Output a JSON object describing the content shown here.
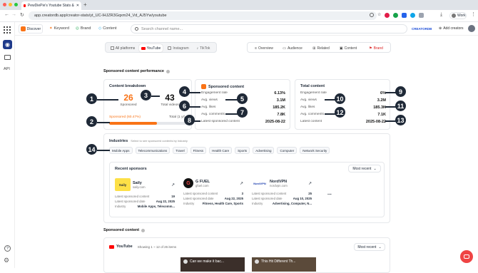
{
  "browser": {
    "tab_title": "PewDiePie's Youtube Stats &",
    "url": "app.creatordb.app/creator-stats/yt_UC-lHJZR3Gqxm24_Vd_AJ5Yw/youtube",
    "profile_label": "Work"
  },
  "topnav": {
    "discover": "Discover",
    "keyword": "Keyword",
    "brand": "Brand",
    "content": "Content",
    "search_placeholder": "Search channel name...",
    "plan_badge": "CREATORDB",
    "add_creators": "Add creators"
  },
  "sidebar": {
    "api_label": "API"
  },
  "platform_tabs": [
    "All platforms",
    "YouTube",
    "Instagram",
    "TikTok"
  ],
  "view_tabs": [
    "Overview",
    "Audience",
    "Related",
    "Content",
    "Brand"
  ],
  "section_title": "Sponsored content performance",
  "breakdown": {
    "title": "Content breakdown",
    "sponsored_value": "26",
    "sponsored_label": "Sponsored",
    "total_value": "43",
    "total_label": "Total videos",
    "bar_sponsored_label": "Sponsored (60.47%)",
    "bar_total_label": "Total (1 yr)",
    "sponsored_fraction": 0.6047
  },
  "sponsored_content": {
    "title": "Sponsored content",
    "rows": [
      {
        "label": "Engagement rate",
        "value": "6.13%"
      },
      {
        "label": "Avg. views",
        "value": "3.1M"
      },
      {
        "label": "Avg. likes",
        "value": "185.2K"
      },
      {
        "label": "Avg. comments",
        "value": "7.8K"
      },
      {
        "label": "Latest sponsored content",
        "value": "2025-08-22"
      }
    ]
  },
  "total_content": {
    "title": "Total content",
    "rows": [
      {
        "label": "Engagement rate",
        "value": "6%"
      },
      {
        "label": "Avg. views",
        "value": "3.2M"
      },
      {
        "label": "Avg. likes",
        "value": "185.3K"
      },
      {
        "label": "Avg. comments",
        "value": "7.1K"
      },
      {
        "label": "Latest content",
        "value": "2025-08-22"
      }
    ]
  },
  "industries": {
    "title": "Industries",
    "subtitle": "Select to see sponsored contents by industry",
    "items": [
      "Mobile Apps",
      "Telecommunications",
      "Travel",
      "Fitness",
      "Health Care",
      "Sports",
      "Advertising",
      "Computer",
      "Network Security"
    ]
  },
  "recent_sponsors": {
    "title": "Recent sponsors",
    "sort": "Most recent",
    "more": "...",
    "items": [
      {
        "name": "Saily",
        "domain": "saily.com",
        "logo_text": "Saily",
        "latest_label": "Latest sponsored content",
        "count": "19",
        "date_label": "Latest sponsored date",
        "date": "Aug 22, 2025",
        "industry_label": "Industry",
        "industry": "Mobile Apps, Telecomm..."
      },
      {
        "name": "G FUEL",
        "domain": "gfuel.com",
        "logo_text": "G",
        "latest_label": "Latest sponsored content",
        "count": "3",
        "date_label": "Latest sponsored date",
        "date": "Aug 22, 2025",
        "industry_label": "Industry",
        "industry": "Fitness, Health Care, Sports"
      },
      {
        "name": "NordVPN",
        "domain": "nordvpn.com",
        "logo_text": "NordVPN",
        "latest_label": "Latest sponsored content",
        "count": "25",
        "date_label": "Latest sponsored date",
        "date": "Aug 10, 2025",
        "industry_label": "Industry",
        "industry": "Advertising, Computer, N..."
      }
    ]
  },
  "sponsored_content_section": {
    "title": "Sponsored content",
    "platform": "YouTube",
    "showing": "Showing 1 ~ 12 of 26 items",
    "sort": "Most recent",
    "thumbs": [
      "Can we make it bac...",
      "This Hit Different Th..."
    ]
  },
  "annotations": [
    "1",
    "2",
    "3",
    "4",
    "5",
    "6",
    "7",
    "8",
    "9",
    "10",
    "11",
    "12",
    "13",
    "14"
  ],
  "colors": {
    "accent": "#f97316",
    "dark": "#1f2937",
    "youtube": "#ff0000",
    "chat": "#ef4444"
  }
}
